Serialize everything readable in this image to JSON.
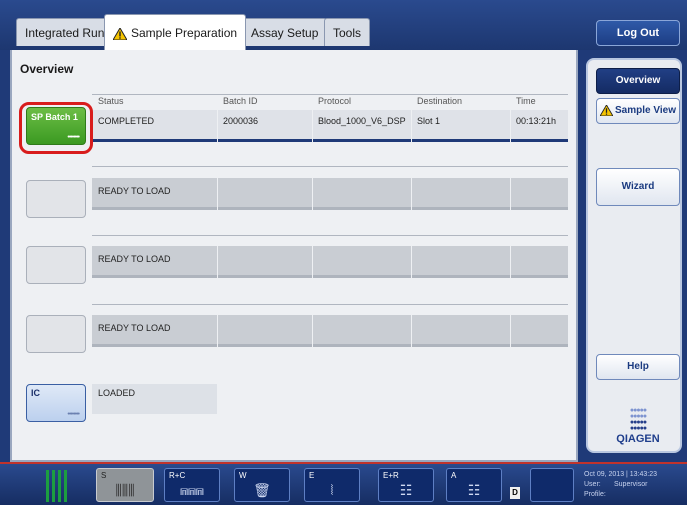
{
  "tabs": [
    {
      "label": "Integrated Run"
    },
    {
      "label": "Sample Preparation",
      "active": true,
      "warning_icon": "warning-triangle-icon"
    },
    {
      "label": "Assay Setup"
    },
    {
      "label": "Tools"
    }
  ],
  "logout_label": "Log Out",
  "main": {
    "title": "Overview",
    "columns": [
      "Status",
      "Batch ID",
      "Protocol",
      "Destination",
      "Time"
    ],
    "batches": [
      {
        "slot_label": "SP Batch 1",
        "slot_dots": "••••••••",
        "status": "COMPLETED",
        "batch_id": "2000036",
        "protocol": "Blood_1000_V6_DSP",
        "destination": "Slot 1",
        "time": "00:13:21h"
      },
      {
        "slot_label": "",
        "status": "READY TO LOAD"
      },
      {
        "slot_label": "",
        "status": "READY TO LOAD"
      },
      {
        "slot_label": "",
        "status": "READY TO LOAD"
      }
    ],
    "ic": {
      "slot_label": "IC",
      "slot_dots": "••••••••",
      "status": "LOADED"
    }
  },
  "right_panel": {
    "overview_label": "Overview",
    "sample_view_label": "Sample View",
    "wizard_label": "Wizard",
    "help_label": "Help",
    "logo_text": "QIAGEN"
  },
  "bottom": {
    "slots": [
      {
        "tag": "S",
        "icon": "tube-rack-icon"
      },
      {
        "tag": "R+C",
        "icon": "reagent-cartridge-icon"
      },
      {
        "tag": "W",
        "icon": "waste-bin-icon"
      },
      {
        "tag": "E",
        "icon": "eluate-icon"
      },
      {
        "tag": "E+R",
        "icon": "eluate-reagent-icon"
      },
      {
        "tag": "A",
        "icon": "assay-icon"
      }
    ],
    "d_badge": "D",
    "status": {
      "date": "Oct 09, 2013 | 13:43:23",
      "user_label": "User:",
      "user_value": "Supervisor",
      "profile_label": "Profile:"
    }
  },
  "colors": {
    "accent": "#1f3a78",
    "completed_green": "#3b9a22",
    "highlight_red": "#d81c1c"
  }
}
